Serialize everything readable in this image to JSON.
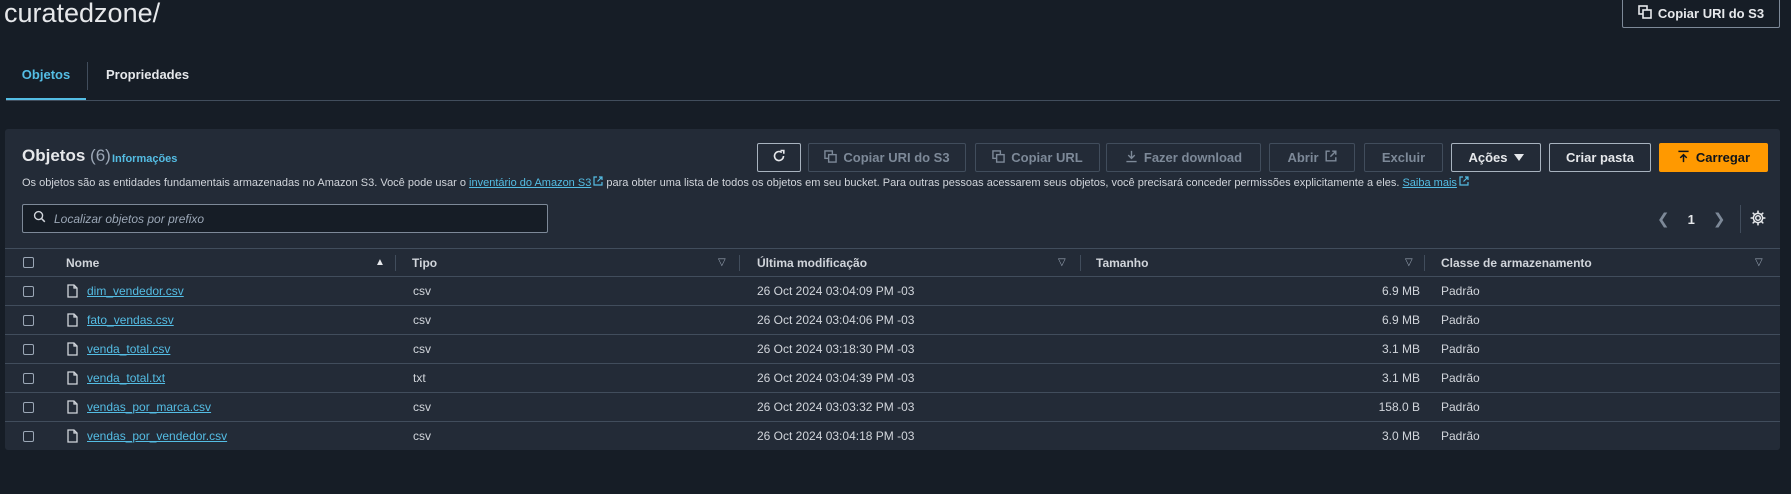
{
  "header": {
    "bucket_path": "curatedzone/",
    "copy_uri_button": "Copiar URI do S3"
  },
  "tabs": [
    {
      "label": "Objetos",
      "active": true
    },
    {
      "label": "Propriedades",
      "active": false
    }
  ],
  "objects_panel": {
    "title": "Objetos",
    "count": "(6)",
    "info_link": "Informações",
    "description": {
      "before": "Os objetos são as entidades fundamentais armazenadas no Amazon S3. Você pode usar o ",
      "inventory_link": "inventário do Amazon S3",
      "middle": " para obter uma lista de todos os objetos em seu bucket. Para outras pessoas acessarem seus objetos, você precisará conceder permissões explicitamente a eles. ",
      "learn_more_link": "Saiba mais"
    },
    "toolbar": {
      "copy_s3_uri": "Copiar URI do S3",
      "copy_url": "Copiar URL",
      "download": "Fazer download",
      "open": "Abrir",
      "delete": "Excluir",
      "actions": "Ações",
      "create_folder": "Criar pasta",
      "upload": "Carregar"
    },
    "search": {
      "placeholder": "Localizar objetos por prefixo",
      "value": ""
    },
    "pagination": {
      "current_page": "1"
    }
  },
  "table": {
    "columns": {
      "name": "Nome",
      "type": "Tipo",
      "last_modified": "Última modificação",
      "size": "Tamanho",
      "storage_class": "Classe de armazenamento"
    },
    "rows": [
      {
        "name": "dim_vendedor.csv",
        "type": "csv",
        "modified": "26 Oct 2024 03:04:09 PM -03",
        "size": "6.9 MB",
        "storage": "Padrão"
      },
      {
        "name": "fato_vendas.csv",
        "type": "csv",
        "modified": "26 Oct 2024 03:04:06 PM -03",
        "size": "6.9 MB",
        "storage": "Padrão"
      },
      {
        "name": "venda_total.csv",
        "type": "csv",
        "modified": "26 Oct 2024 03:18:30 PM -03",
        "size": "3.1 MB",
        "storage": "Padrão"
      },
      {
        "name": "venda_total.txt",
        "type": "txt",
        "modified": "26 Oct 2024 03:04:39 PM -03",
        "size": "3.1 MB",
        "storage": "Padrão"
      },
      {
        "name": "vendas_por_marca.csv",
        "type": "csv",
        "modified": "26 Oct 2024 03:03:32 PM -03",
        "size": "158.0 B",
        "storage": "Padrão"
      },
      {
        "name": "vendas_por_vendedor.csv",
        "type": "csv",
        "modified": "26 Oct 2024 03:04:18 PM -03",
        "size": "3.0 MB",
        "storage": "Padrão"
      }
    ]
  },
  "colors": {
    "background": "#161d26",
    "panel": "#232b37",
    "link": "#54bde4",
    "primary": "#ff9900"
  }
}
